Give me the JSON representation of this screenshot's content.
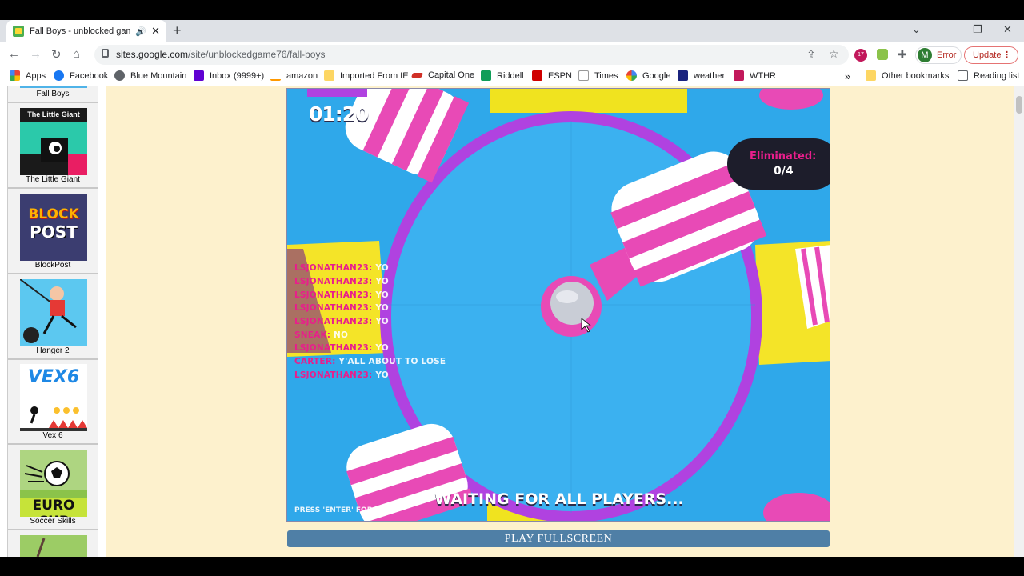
{
  "browser": {
    "tab_title": "Fall Boys - unblocked games",
    "url_host": "sites.google.com",
    "url_path": "/site/unblockedgame76/fall-boys",
    "profile_initial": "M",
    "profile_status": "Error",
    "update_label": "Update",
    "extension_badge": "17"
  },
  "bookmarks": [
    {
      "label": "Apps",
      "color": "#ea4335"
    },
    {
      "label": "Facebook",
      "color": "#1877f2"
    },
    {
      "label": "Blue Mountain",
      "color": "#5f6368"
    },
    {
      "label": "Inbox (9999+)",
      "color": "#6001d2"
    },
    {
      "label": "amazon",
      "color": "#222222"
    },
    {
      "label": "Imported From IE",
      "color": "#fdd663"
    },
    {
      "label": "Capital One",
      "color": "#d03027"
    },
    {
      "label": "Riddell",
      "color": "#0f9d58"
    },
    {
      "label": "ESPN",
      "color": "#d00000"
    },
    {
      "label": "Times",
      "color": "#999999"
    },
    {
      "label": "Google",
      "color": "#4285f4"
    },
    {
      "label": "weather",
      "color": "#1a237e"
    },
    {
      "label": "WTHR",
      "color": "#c2185b"
    }
  ],
  "bookmarks_right": {
    "other": "Other bookmarks",
    "reading": "Reading list",
    "more": "»"
  },
  "sidebar": {
    "items": [
      {
        "label": "Fall Boys"
      },
      {
        "label": "The Little Giant",
        "thumb_text": "The Little Giant"
      },
      {
        "label": "BlockPost",
        "thumb_text_1": "BLOCK",
        "thumb_text_2": "POST"
      },
      {
        "label": "Hanger 2"
      },
      {
        "label": "Vex 6",
        "thumb_text": "VEX6"
      },
      {
        "label": "Soccer Skills",
        "thumb_text": "EURO CUP"
      }
    ]
  },
  "game": {
    "timer": "01:20",
    "eliminated_label": "Eliminated:",
    "eliminated_count": "0/4",
    "waiting_text": "WAITING FOR ALL PLAYERS...",
    "chat_hint": "PRESS 'ENTER' FOR CHAT",
    "chat": [
      {
        "name": "LSJONATHAN23:",
        "msg": "YO"
      },
      {
        "name": "LSJONATHAN23:",
        "msg": "YO"
      },
      {
        "name": "LSJONATHAN23:",
        "msg": "YO"
      },
      {
        "name": "LSJONATHAN23:",
        "msg": "YO"
      },
      {
        "name": "LSJONATHAN23:",
        "msg": "YO"
      },
      {
        "name": "SNEAK:",
        "msg": "NO"
      },
      {
        "name": "LSJONATHAN23:",
        "msg": "YO"
      },
      {
        "name": "CARTER:",
        "msg": "Y'ALL ABOUT TO LOSE"
      },
      {
        "name": "LSJONATHAN23:",
        "msg": "YO"
      }
    ]
  },
  "page": {
    "fullscreen_button": "PLAY FULLSCREEN"
  }
}
